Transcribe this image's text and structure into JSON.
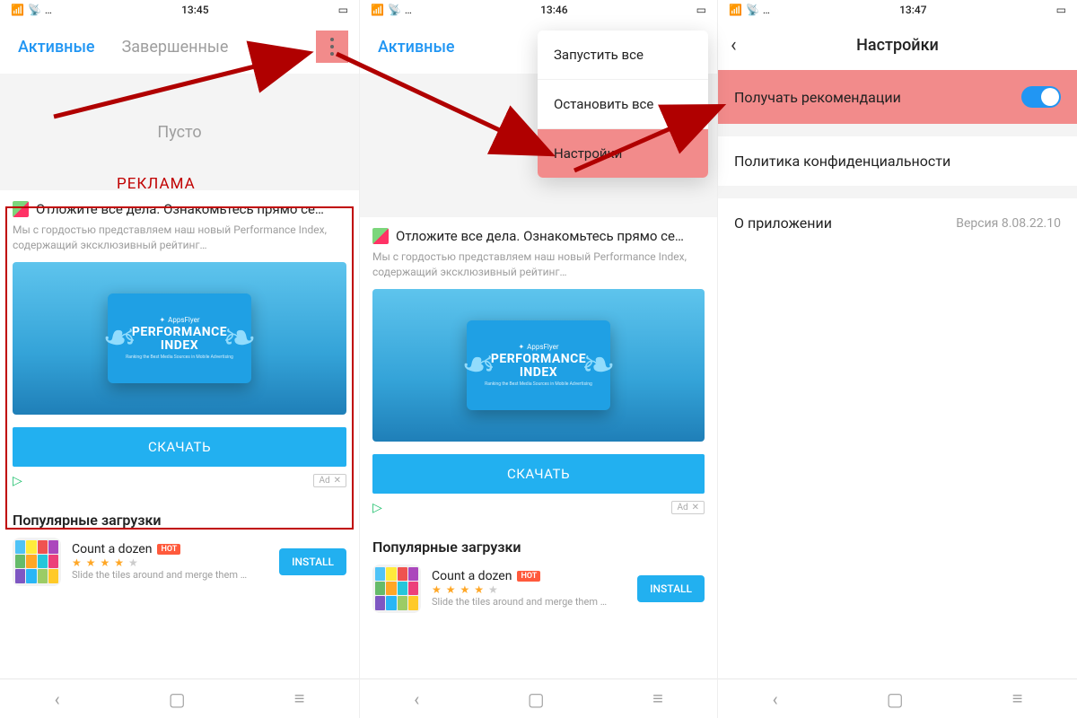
{
  "screen1": {
    "time": "13:45",
    "tab_active": "Активные",
    "tab_done": "Завершенные",
    "empty_text": "Пусто",
    "annotation_label": "РЕКЛАМА"
  },
  "screen2": {
    "time": "13:46",
    "tab_active": "Активные",
    "menu": {
      "start_all": "Запустить все",
      "stop_all": "Остановить все",
      "settings": "Настройки"
    }
  },
  "screen3": {
    "time": "13:47",
    "title": "Настройки",
    "row_recommend": "Получать рекомендации",
    "row_privacy": "Политика конфиденциальности",
    "row_about": "О приложении",
    "version_label": "Версия 8.08.22.10"
  },
  "ad": {
    "title": "Отложите все дела. Ознакомьтесь прямо се…",
    "sub": "Мы с гордостью представляем наш новый Performance Index, содержащий эксклюзивный рейтинг…",
    "brand": "AppsFlyer",
    "index_line1": "PERFORMANCE",
    "index_line2": "INDEX",
    "index_sub": "Ranking the Best Media Sources in Mobile Advertising",
    "cta": "СКАЧАТЬ",
    "tag": "Ad"
  },
  "popular": {
    "section_title": "Популярные загрузки",
    "app_name": "Count a dozen",
    "hot": "HOT",
    "app_desc": "Slide the tiles around and merge them …",
    "install": "INSTALL"
  }
}
